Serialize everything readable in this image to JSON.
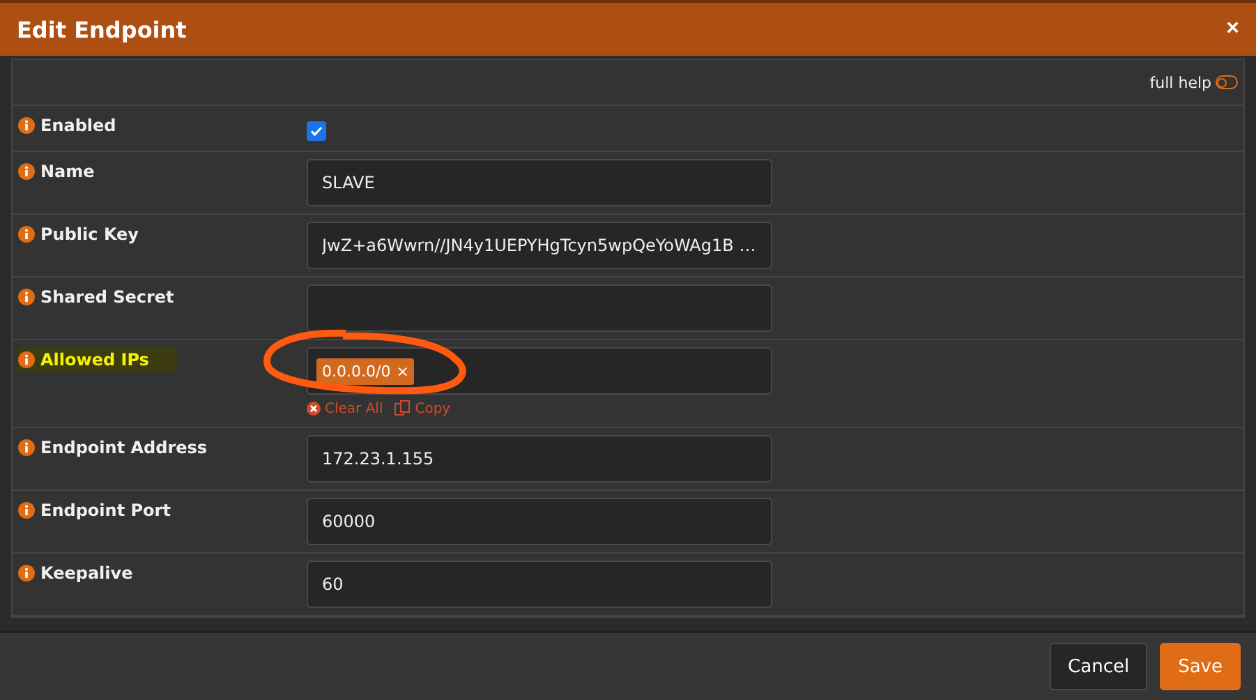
{
  "dialog": {
    "title": "Edit Endpoint",
    "close": "×"
  },
  "full_help": {
    "label": "full help",
    "on": false
  },
  "fields": [
    {
      "kind": "checkbox",
      "label": "Enabled",
      "checked": true,
      "highlighted": false
    },
    {
      "kind": "text",
      "label": "Name",
      "value": "SLAVE",
      "highlighted": false
    },
    {
      "kind": "text",
      "label": "Public Key",
      "value": "JwZ+a6Wwrn//JN4y1UEPYHgTcyn5wpQeYoWAg1B …",
      "highlighted": false
    },
    {
      "kind": "text",
      "label": "Shared Secret",
      "highlighted": false
    },
    {
      "kind": "tags",
      "label": "Allowed IPs",
      "tags": [
        {
          "text": "0.0.0.0/0",
          "remove": "×"
        }
      ],
      "actions": [
        "Clear All",
        "Copy"
      ],
      "highlighted": true,
      "circled": true
    },
    {
      "kind": "text",
      "label": "Endpoint Address",
      "value": "172.23.1.155",
      "highlighted": false
    },
    {
      "kind": "text",
      "label": "Endpoint Port",
      "value": "60000",
      "highlighted": false
    },
    {
      "kind": "text",
      "label": "Keepalive",
      "value": "60",
      "highlighted": false
    }
  ],
  "buttons": [
    {
      "label": "Cancel",
      "kind": "secondary"
    },
    {
      "label": "Save",
      "kind": "primary"
    }
  ]
}
